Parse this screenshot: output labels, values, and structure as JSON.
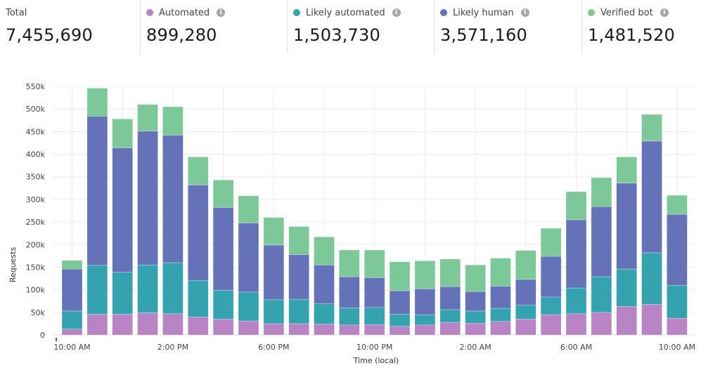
{
  "stats": [
    {
      "label": "Total",
      "value": "7,455,690",
      "color": null,
      "info": false
    },
    {
      "label": "Automated",
      "value": "899,280",
      "color": "#b884c4",
      "info": true
    },
    {
      "label": "Likely automated",
      "value": "1,503,730",
      "color": "#35a2b0",
      "info": true
    },
    {
      "label": "Likely human",
      "value": "3,571,160",
      "color": "#6473b7",
      "info": true
    },
    {
      "label": "Verified bot",
      "value": "1,481,520",
      "color": "#7cc898",
      "info": true
    }
  ],
  "info_icon_glyph": "i",
  "chart_data": {
    "type": "bar",
    "stacked": true,
    "title": "",
    "xlabel": "Time (local)",
    "ylabel": "Requests",
    "ylim": [
      0,
      550000
    ],
    "yticks": [
      0,
      50000,
      100000,
      150000,
      200000,
      250000,
      300000,
      350000,
      400000,
      450000,
      500000,
      550000
    ],
    "ytick_labels": [
      "0",
      "50k",
      "100k",
      "150k",
      "200k",
      "250k",
      "300k",
      "350k",
      "400k",
      "450k",
      "500k",
      "550k"
    ],
    "xtick_labels": [
      {
        "index": 0,
        "label": "10:00 AM"
      },
      {
        "index": 4,
        "label": "2:00 PM"
      },
      {
        "index": 8,
        "label": "6:00 PM"
      },
      {
        "index": 12,
        "label": "10:00 PM"
      },
      {
        "index": 16,
        "label": "2:00 AM"
      },
      {
        "index": 20,
        "label": "6:00 AM"
      },
      {
        "index": 24,
        "label": "10:00 AM"
      }
    ],
    "grid": true,
    "categories": [
      "10:00 AM",
      "11:00 AM",
      "12:00 PM",
      "1:00 PM",
      "2:00 PM",
      "3:00 PM",
      "4:00 PM",
      "5:00 PM",
      "6:00 PM",
      "7:00 PM",
      "8:00 PM",
      "9:00 PM",
      "10:00 PM",
      "11:00 PM",
      "12:00 AM",
      "1:00 AM",
      "2:00 AM",
      "3:00 AM",
      "4:00 AM",
      "5:00 AM",
      "6:00 AM",
      "7:00 AM",
      "8:00 AM",
      "9:00 AM",
      "10:00 AM"
    ],
    "series": [
      {
        "name": "Automated",
        "color": "#b884c4",
        "values": [
          13000,
          46000,
          46000,
          49000,
          47000,
          40000,
          35000,
          31000,
          25000,
          25000,
          24000,
          22000,
          23000,
          19000,
          22000,
          28000,
          26000,
          30000,
          35000,
          45000,
          47000,
          50000,
          63000,
          68000,
          37000
        ]
      },
      {
        "name": "Likely automated",
        "color": "#35a2b0",
        "values": [
          40000,
          108000,
          93000,
          106000,
          113000,
          80000,
          64000,
          64000,
          53000,
          54000,
          45000,
          38000,
          38000,
          27000,
          23000,
          28000,
          27000,
          29000,
          31000,
          39000,
          57000,
          79000,
          83000,
          114000,
          73000
        ]
      },
      {
        "name": "Likely human",
        "color": "#6473b7",
        "values": [
          93000,
          330000,
          275000,
          296000,
          282000,
          212000,
          183000,
          153000,
          121000,
          99000,
          86000,
          69000,
          66000,
          52000,
          57000,
          51000,
          43000,
          49000,
          57000,
          90000,
          151000,
          155000,
          190000,
          247000,
          157000
        ]
      },
      {
        "name": "Verified bot",
        "color": "#7cc898",
        "values": [
          19000,
          62000,
          64000,
          59000,
          63000,
          62000,
          61000,
          60000,
          61000,
          62000,
          62000,
          59000,
          61000,
          64000,
          62000,
          61000,
          59000,
          62000,
          64000,
          62000,
          62000,
          64000,
          58000,
          59000,
          42000
        ]
      }
    ]
  }
}
